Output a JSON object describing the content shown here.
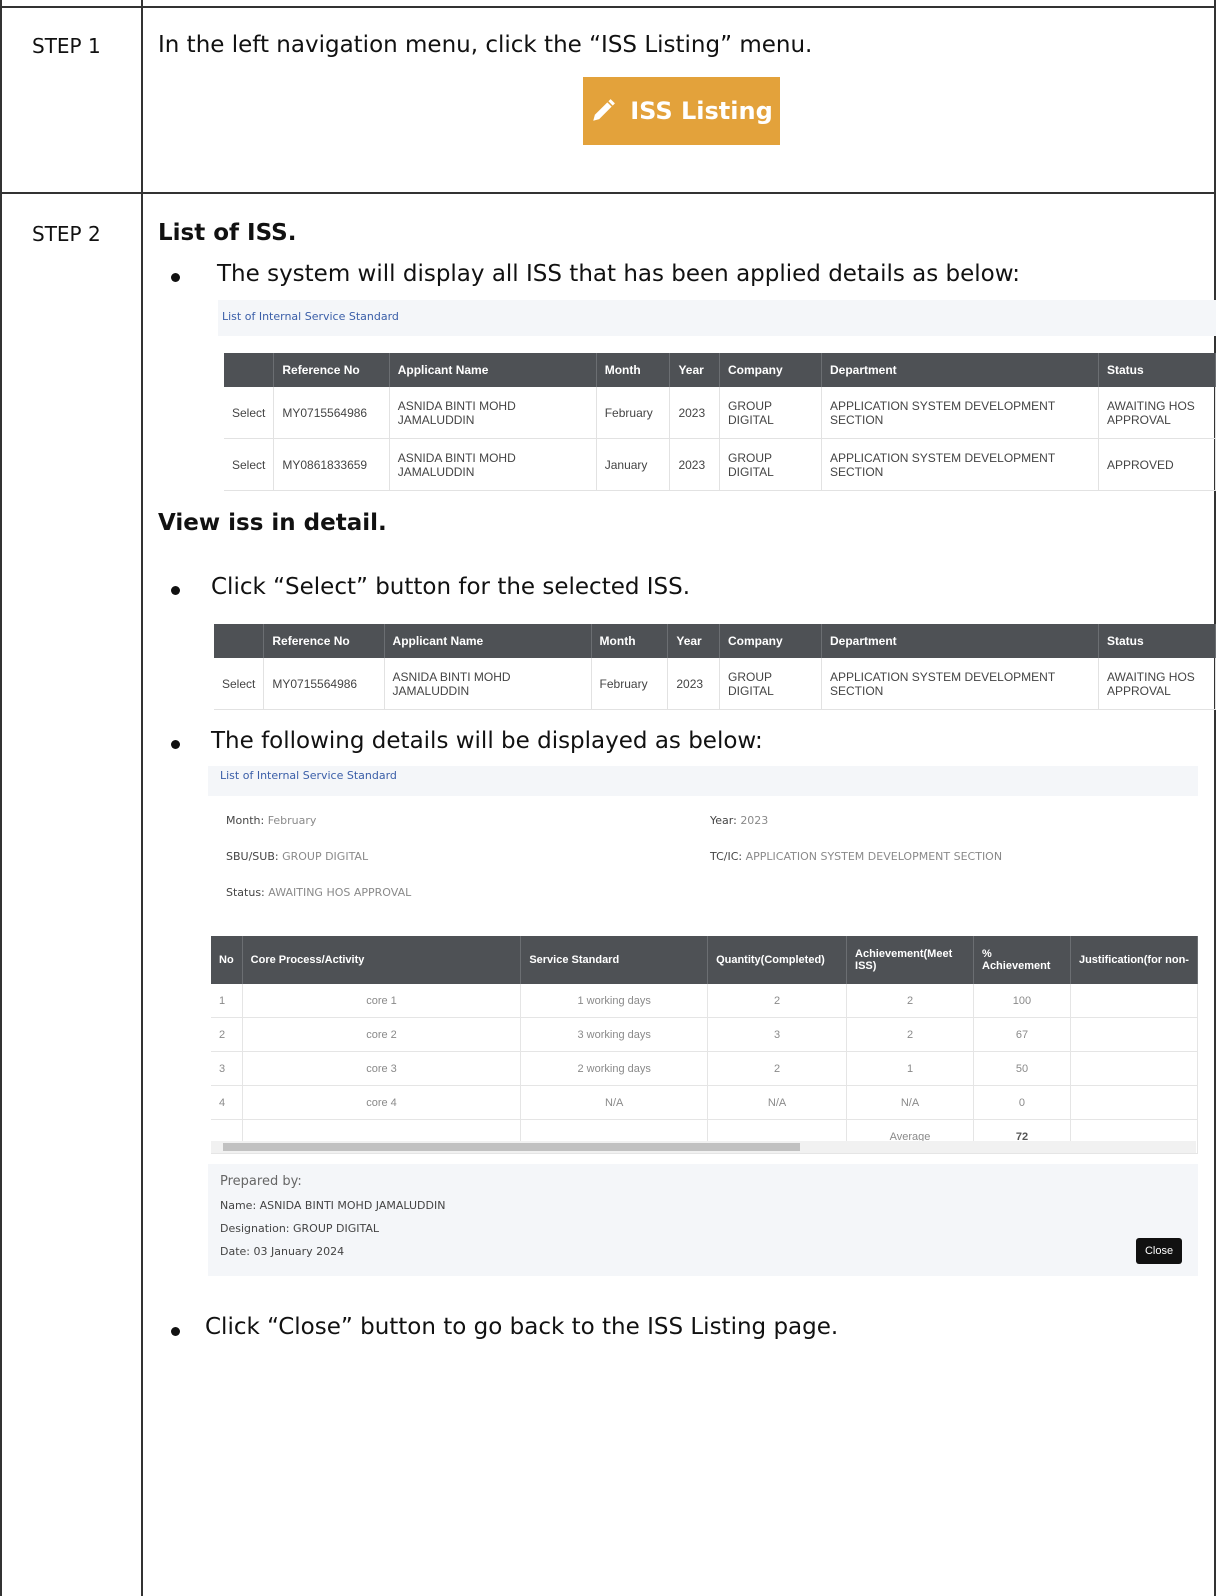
{
  "step1": {
    "label": "STEP 1",
    "instruction": "In the left navigation menu, click the “ISS Listing” menu.",
    "button_label": "ISS Listing",
    "button_icon": "pencil-icon",
    "button_color": "#e3a23b"
  },
  "step2": {
    "label": "STEP 2",
    "heading_list": "List of ISS.",
    "bullet_list": "The system will display all ISS that has been applied details as below:",
    "heading_view": "View iss in detail.",
    "bullet_select": "Click “Select” button for the selected ISS.",
    "bullet_details": "The following details will be displayed as below:",
    "bullet_close": "Click “Close” button to go back to the ISS Listing page."
  },
  "listing": {
    "title": "List of Internal Service Standard",
    "columns": [
      "",
      "Reference No",
      "Applicant Name",
      "Month",
      "Year",
      "Company",
      "Department",
      "Status"
    ],
    "rows": [
      {
        "action": "Select",
        "ref": "MY0715564986",
        "name": "ASNIDA BINTI MOHD JAMALUDDIN",
        "month": "February",
        "year": "2023",
        "company": "GROUP DIGITAL",
        "department": "APPLICATION SYSTEM DEVELOPMENT SECTION",
        "status": "AWAITING HOS APPROVAL"
      },
      {
        "action": "Select",
        "ref": "MY0861833659",
        "name": "ASNIDA BINTI MOHD JAMALUDDIN",
        "month": "January",
        "year": "2023",
        "company": "GROUP DIGITAL",
        "department": "APPLICATION SYSTEM DEVELOPMENT SECTION",
        "status": "APPROVED"
      }
    ]
  },
  "detail": {
    "title": "List of Internal Service Standard",
    "month_label": "Month:",
    "month_value": "February",
    "year_label": "Year:",
    "year_value": "2023",
    "sbu_label": "SBU/SUB:",
    "sbu_value": "GROUP DIGITAL",
    "tcic_label": "TC/IC:",
    "tcic_value": "APPLICATION SYSTEM DEVELOPMENT SECTION",
    "status_label": "Status:",
    "status_value": "AWAITING HOS APPROVAL",
    "columns": [
      "No",
      "Core Process/Activity",
      "Service Standard",
      "Quantity(Completed)",
      "Achievement(Meet ISS)",
      "% Achievement",
      "Justification(for non-"
    ],
    "rows": [
      {
        "no": "1",
        "core": "core 1",
        "standard": "1 working days",
        "qty": "2",
        "ach": "2",
        "pct": "100"
      },
      {
        "no": "2",
        "core": "core 2",
        "standard": "3 working days",
        "qty": "3",
        "ach": "2",
        "pct": "67"
      },
      {
        "no": "3",
        "core": "core 3",
        "standard": "2 working days",
        "qty": "2",
        "ach": "1",
        "pct": "50"
      },
      {
        "no": "4",
        "core": "core 4",
        "standard": "N/A",
        "qty": "N/A",
        "ach": "N/A",
        "pct": "0"
      }
    ],
    "average_label": "Average",
    "average_value": "72",
    "prepared_by": "Prepared by:",
    "prep_name": "Name: ASNIDA BINTI MOHD JAMALUDDIN",
    "prep_designation": "Designation: GROUP DIGITAL",
    "prep_date": "Date: 03 January 2024",
    "close_label": "Close"
  }
}
